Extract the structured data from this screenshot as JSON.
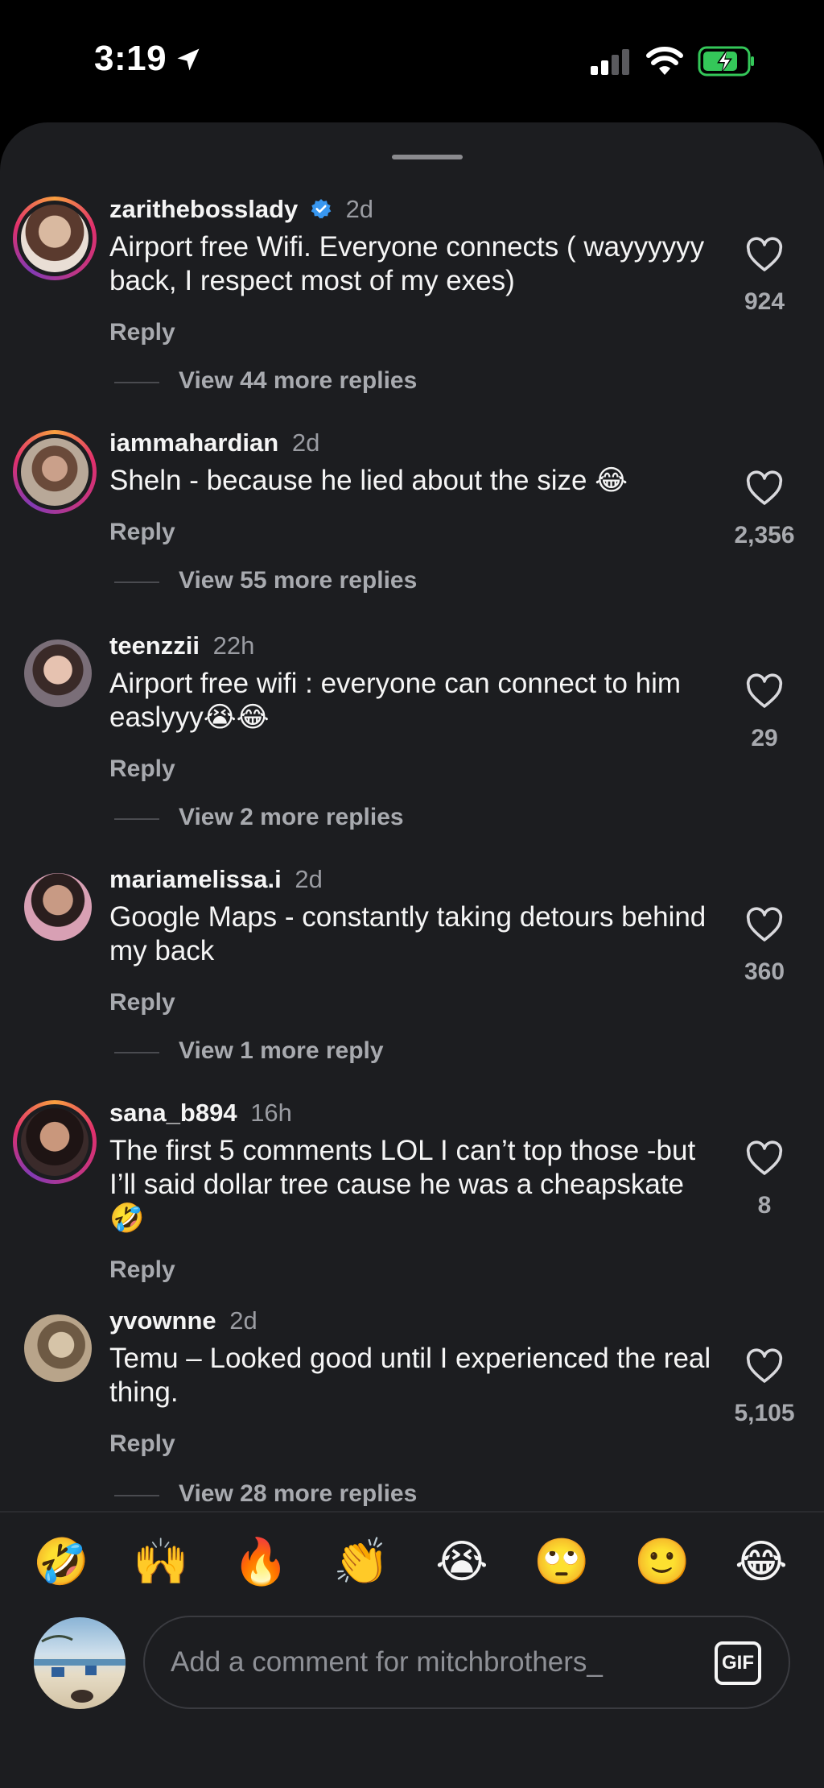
{
  "status_bar": {
    "time": "3:19",
    "icons": [
      "location-arrow-icon",
      "cellular-signal-icon",
      "wifi-icon",
      "battery-charging-icon"
    ]
  },
  "colors": {
    "sheet_bg": "#1c1d20",
    "battery_green": "#34c759",
    "verified_blue": "#3897f0",
    "muted_text": "#a8aaaf"
  },
  "comments": [
    {
      "username": "zarithebosslady",
      "verified": true,
      "ago": "2d",
      "text": "Airport free Wifi. Everyone connects ( wayyyyyy back, I respect most of my exes)",
      "reply_label": "Reply",
      "likes": "924",
      "view_more": "View 44 more replies",
      "story_ring": true
    },
    {
      "username": "iammahardian",
      "ago": "2d",
      "text": "Sheln - because he lied about the size 😂",
      "reply_label": "Reply",
      "likes": "2,356",
      "view_more": "View 55 more replies",
      "story_ring": true
    },
    {
      "username": "teenzzii",
      "ago": "22h",
      "text": "Airport free wifi : everyone can connect to him easlyyy😭😂",
      "reply_label": "Reply",
      "likes": "29",
      "view_more": "View 2 more replies",
      "story_ring": false
    },
    {
      "username": "mariamelissa.i",
      "ago": "2d",
      "text": "Google Maps - constantly taking detours behind my back",
      "reply_label": "Reply",
      "likes": "360",
      "view_more": "View 1 more reply",
      "story_ring": false
    },
    {
      "username": "sana_b894",
      "ago": "16h",
      "text": "The first 5 comments LOL I can’t top those -but I’ll said dollar tree cause he was a cheapskate 🤣",
      "reply_label": "Reply",
      "likes": "8",
      "story_ring": true
    },
    {
      "username": "yvownne",
      "ago": "2d",
      "text": "Temu – Looked good until I experienced the real thing.",
      "reply_label": "Reply",
      "likes": "5,105",
      "view_more": "View 28 more replies",
      "story_ring": false
    }
  ],
  "quick_emojis": [
    "🤣",
    "🙌",
    "🔥",
    "👏",
    "😭",
    "🙄",
    "🙂",
    "😂"
  ],
  "composer": {
    "placeholder": "Add a comment for mitchbrothers_",
    "gif_label": "GIF"
  }
}
